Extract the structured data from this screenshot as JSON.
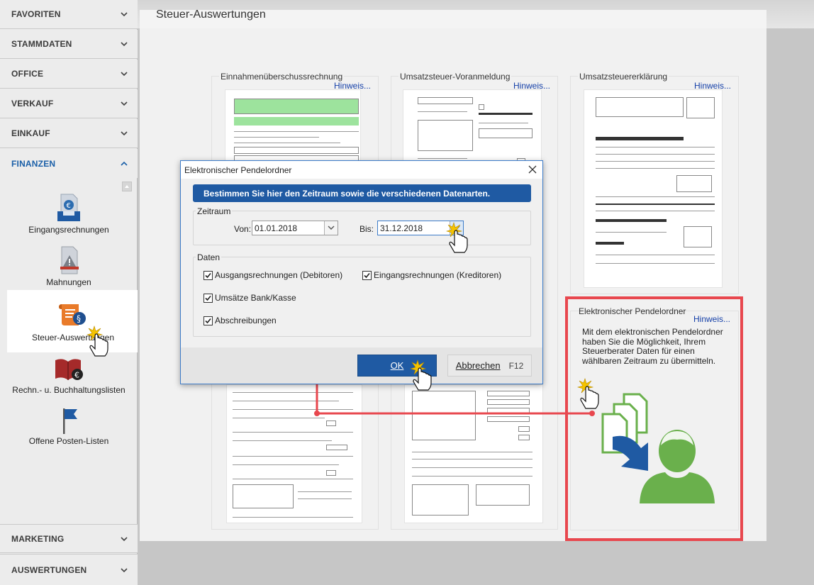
{
  "sidebar": {
    "sections": [
      {
        "label": "FAVORITEN",
        "state": "collapsed"
      },
      {
        "label": "STAMMDATEN",
        "state": "collapsed"
      },
      {
        "label": "OFFICE",
        "state": "collapsed"
      },
      {
        "label": "VERKAUF",
        "state": "collapsed"
      },
      {
        "label": "EINKAUF",
        "state": "collapsed"
      },
      {
        "label": "FINANZEN",
        "state": "expanded"
      },
      {
        "label": "MARKETING",
        "state": "collapsed"
      },
      {
        "label": "AUSWERTUNGEN",
        "state": "collapsed"
      }
    ],
    "finanzen_items": [
      {
        "label": "Eingangsrechnungen",
        "icon": "invoice-tray-icon"
      },
      {
        "label": "Mahnungen",
        "icon": "warning-document-icon"
      },
      {
        "label": "Steuer-Auswertungen",
        "icon": "tax-scroll-icon",
        "selected": true
      },
      {
        "label": "Rechn.- u. Buchhaltungslisten",
        "icon": "ledger-book-icon"
      },
      {
        "label": "Offene Posten-Listen",
        "icon": "flag-icon"
      }
    ]
  },
  "main": {
    "title": "Steuer-Auswertungen",
    "cards": [
      {
        "title": "Einnahmenüberschussrechnung",
        "hint": "Hinweis..."
      },
      {
        "title": "Umsatzsteuer-Voranmeldung",
        "hint": "Hinweis..."
      },
      {
        "title": "Umsatzsteuererklärung",
        "hint": "Hinweis..."
      },
      {
        "title": "Elektronischer Pendelordner",
        "hint": "Hinweis...",
        "description": "Mit dem elektronischen Pendelordner haben Sie die Möglichkeit, Ihrem Steuerberater Daten für einen wählbaren Zeitraum zu übermitteln."
      }
    ]
  },
  "dialog": {
    "title": "Elektronischer Pendelordner",
    "banner": "Bestimmen Sie hier den Zeitraum sowie die verschiedenen Datenarten.",
    "zeitraum": {
      "group_label": "Zeitraum",
      "von_label": "Von:",
      "von_value": "01.01.2018",
      "bis_label": "Bis:",
      "bis_value": "31.12.2018"
    },
    "daten": {
      "group_label": "Daten",
      "options": [
        {
          "label": "Ausgangsrechnungen (Debitoren)",
          "checked": true
        },
        {
          "label": "Eingangsrechnungen (Kreditoren)",
          "checked": true
        },
        {
          "label": "Umsätze Bank/Kasse",
          "checked": true
        },
        {
          "label": "Abschreibungen",
          "checked": true
        }
      ]
    },
    "buttons": {
      "ok_label": "OK",
      "cancel_label": "Abbrechen",
      "cancel_key": "F12"
    }
  },
  "colors": {
    "accent": "#1f5aa3",
    "highlight": "#e8474e",
    "link": "#1540a8",
    "icon_green": "#6ab04c"
  }
}
